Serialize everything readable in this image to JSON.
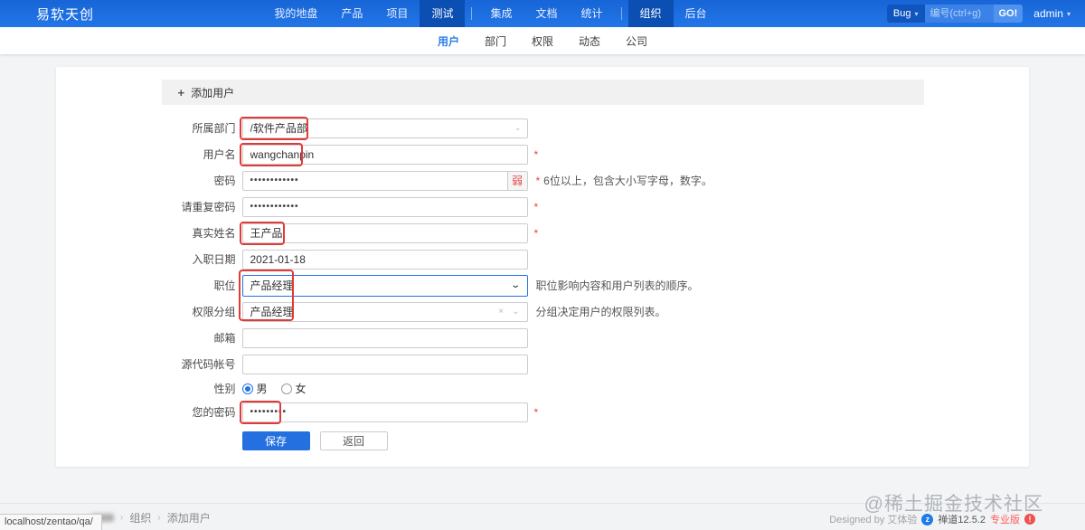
{
  "icons": {
    "caret_down": "▾",
    "chevron_down": "⌄",
    "clear": "×",
    "plus": "+",
    "zentao_logo": "z",
    "help": "!"
  },
  "topbar": {
    "logo": "易软天创",
    "nav": [
      {
        "label": "我的地盘"
      },
      {
        "label": "产品"
      },
      {
        "label": "项目"
      },
      {
        "label": "测试",
        "active": true
      },
      {
        "label": "集成"
      },
      {
        "label": "文档"
      },
      {
        "label": "统计"
      },
      {
        "label": "组织",
        "active": true
      },
      {
        "label": "后台"
      }
    ],
    "search": {
      "module": "Bug",
      "placeholder": "编号(ctrl+g)",
      "go": "GO!"
    },
    "user": {
      "name": "admin"
    }
  },
  "subnav": [
    {
      "label": "用户",
      "active": true
    },
    {
      "label": "部门"
    },
    {
      "label": "权限"
    },
    {
      "label": "动态"
    },
    {
      "label": "公司"
    }
  ],
  "form": {
    "header": "添加用户",
    "rows": {
      "dept": {
        "label": "所属部门",
        "value": "/软件产品部"
      },
      "account": {
        "label": "用户名",
        "value": "wangchanpin",
        "required": "*"
      },
      "password": {
        "label": "密码",
        "value": "••••••••••••",
        "strength": "弱",
        "hint_star": "*",
        "hint": "6位以上，包含大小写字母，数字。"
      },
      "password2": {
        "label": "请重复密码",
        "value": "••••••••••••",
        "required": "*"
      },
      "realname": {
        "label": "真实姓名",
        "value": "王产品",
        "required": "*"
      },
      "join": {
        "label": "入职日期",
        "value": "2021-01-18"
      },
      "role": {
        "label": "职位",
        "value": "产品经理",
        "hint": "职位影响内容和用户列表的顺序。"
      },
      "group": {
        "label": "权限分组",
        "value": "产品经理",
        "hint": "分组决定用户的权限列表。"
      },
      "email": {
        "label": "邮箱",
        "value": ""
      },
      "commiter": {
        "label": "源代码帐号",
        "value": ""
      },
      "gender": {
        "label": "性别",
        "male": "男",
        "female": "女"
      },
      "verify": {
        "label": "您的密码",
        "value": "•••••••••",
        "required": "*"
      }
    },
    "buttons": {
      "save": "保存",
      "back": "返回"
    }
  },
  "footer": {
    "breadcrumb": {
      "org": "组织",
      "page": "添加用户",
      "sep": "›"
    },
    "statusbar": "localhost/zentao/qa/",
    "designed_by": "Designed by 艾体验",
    "version": "禅道12.5.2",
    "edition": "专业版",
    "watermark": "@稀土掘金技术社区"
  }
}
